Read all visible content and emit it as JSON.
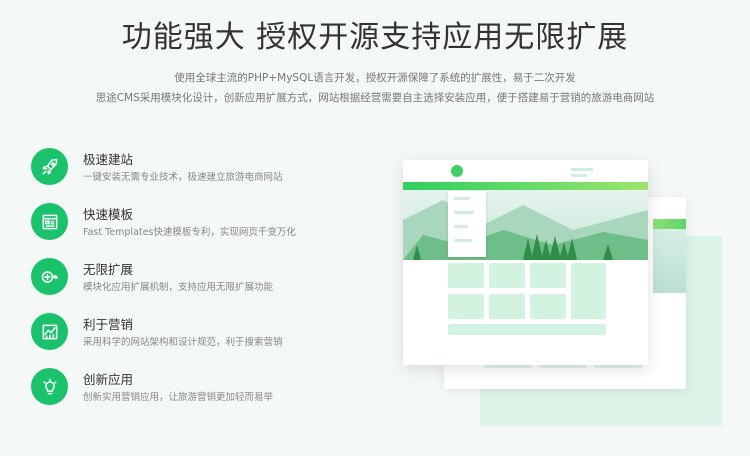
{
  "header": {
    "title": "功能强大 授权开源支持应用无限扩展",
    "desc_line1": "使用全球主流的PHP+MySQL语言开发，授权开源保障了系统的扩展性，易于二次开发",
    "desc_line2": "思途CMS采用模块化设计，创新应用扩展方式，网站根据经营需要自主选择安装应用，便于搭建易于营销的旅游电商网站"
  },
  "features": [
    {
      "icon": "rocket-icon",
      "title": "极速建站",
      "desc": "一键安装无需专业技术，极速建立旅游电商网站"
    },
    {
      "icon": "template-icon",
      "title": "快速模板",
      "desc": "Fast Templates快速模板专利，实现网页千变万化"
    },
    {
      "icon": "plus-infinity-icon",
      "title": "无限扩展",
      "desc": "模块化应用扩展机制，支持应用无限扩展功能"
    },
    {
      "icon": "chart-icon",
      "title": "利于营销",
      "desc": "采用科学的网站架构和设计规范，利于搜索营销"
    },
    {
      "icon": "lightbulb-icon",
      "title": "创新应用",
      "desc": "创新实用营销应用，让旅游营销更加轻而易举"
    }
  ],
  "colors": {
    "accent": "#19c26b",
    "light_green": "#d2f3e0",
    "background": "#f4f8f6"
  }
}
